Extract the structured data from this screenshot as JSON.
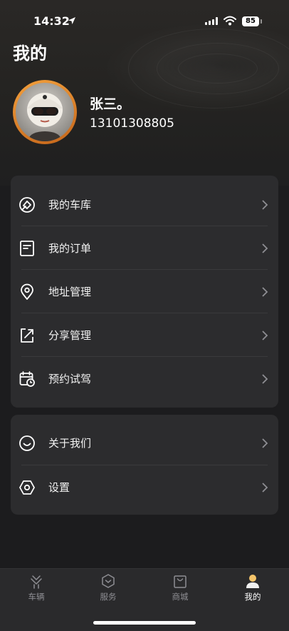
{
  "status_bar": {
    "time": "14:32",
    "battery": "85"
  },
  "page": {
    "title": "我的"
  },
  "profile": {
    "name": "张三。",
    "phone": "13101308805"
  },
  "menu_primary": [
    {
      "label": "我的车库",
      "icon": "garage-icon"
    },
    {
      "label": "我的订单",
      "icon": "order-icon"
    },
    {
      "label": "地址管理",
      "icon": "location-pin-icon"
    },
    {
      "label": "分享管理",
      "icon": "share-icon"
    },
    {
      "label": "预约试驾",
      "icon": "calendar-clock-icon"
    }
  ],
  "menu_secondary": [
    {
      "label": "关于我们",
      "icon": "smile-icon"
    },
    {
      "label": "设置",
      "icon": "settings-hexagon-icon"
    }
  ],
  "tabbar": {
    "items": [
      {
        "label": "车辆",
        "icon": "vehicle-icon",
        "active": false
      },
      {
        "label": "服务",
        "icon": "service-icon",
        "active": false
      },
      {
        "label": "商城",
        "icon": "shopping-bag-icon",
        "active": false
      },
      {
        "label": "我的",
        "icon": "person-icon",
        "active": true
      }
    ]
  },
  "colors": {
    "accent": "#f3a03c",
    "background": "#1c1c1e",
    "card": "#2c2c2e"
  }
}
